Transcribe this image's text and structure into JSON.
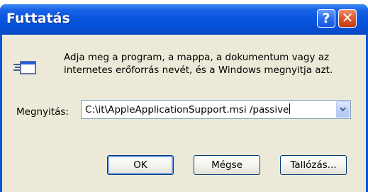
{
  "window": {
    "title": "Futtatás",
    "help_icon": "help-question-icon",
    "close_icon": "close-x-icon"
  },
  "dialog": {
    "icon": "run-icon",
    "description_line1": "Adja meg a program, a mappa, a dokumentum vagy az",
    "description_line2": "internetes erőforrás nevét, és a Windows megnyitja azt.",
    "open_label": "Megnyitás:",
    "open_value": "C:\\it\\AppleApplicationSupport.msi /passive"
  },
  "buttons": {
    "ok": "OK",
    "cancel": "Mégse",
    "browse": "Tallózás..."
  },
  "colors": {
    "titlebar": "#0a56e0",
    "dialog_bg": "#ece9d8",
    "close_button": "#e05a30"
  }
}
